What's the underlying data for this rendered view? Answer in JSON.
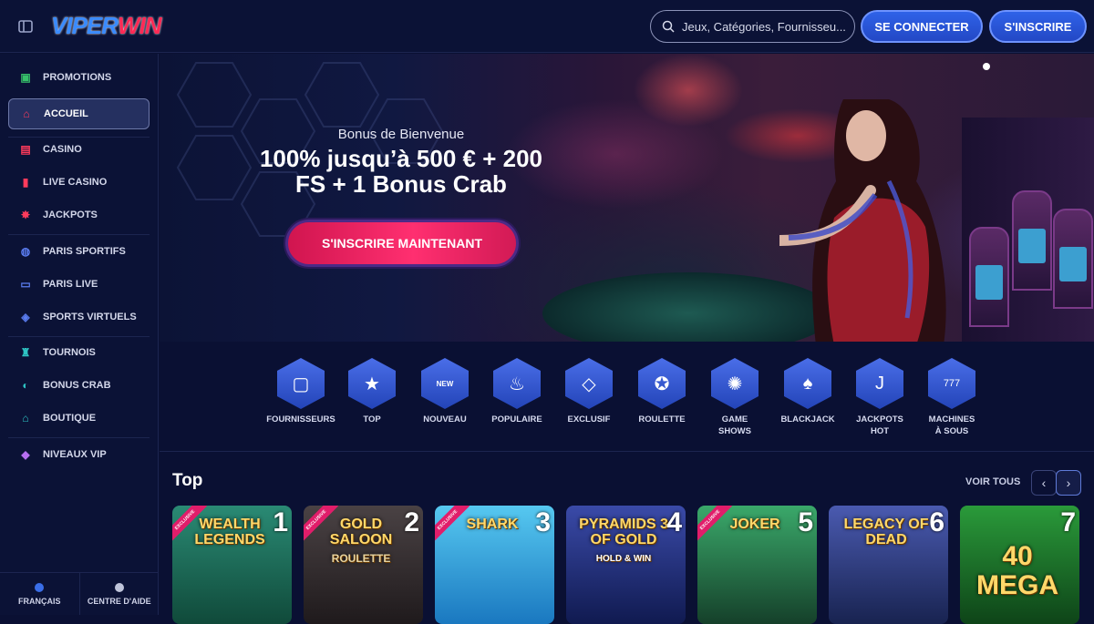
{
  "header": {
    "logo_part1": "VIPER",
    "logo_part2": "WIN",
    "search_placeholder": "Jeux, Catégories, Fournisseu...",
    "login_label": "SE CONNECTER",
    "signup_label": "S'INSCRIRE"
  },
  "sidebar": {
    "items": [
      {
        "label": "PROMOTIONS",
        "icon": "gift-icon",
        "color": "#37c06a"
      },
      {
        "label": "ACCUEIL",
        "icon": "home-icon",
        "color": "#ff3b5c"
      },
      {
        "label": "CASINO",
        "icon": "slot-machine-icon",
        "color": "#ff3b5c"
      },
      {
        "label": "LIVE CASINO",
        "icon": "cards-icon",
        "color": "#ff3b5c"
      },
      {
        "label": "JACKPOTS",
        "icon": "jackpot-icon",
        "color": "#ff3b5c"
      },
      {
        "label": "PARIS SPORTIFS",
        "icon": "ball-icon",
        "color": "#5a7cf0"
      },
      {
        "label": "PARIS LIVE",
        "icon": "live-icon",
        "color": "#5a7cf0"
      },
      {
        "label": "SPORTS VIRTUELS",
        "icon": "gamepad-icon",
        "color": "#5a7cf0"
      },
      {
        "label": "TOURNOIS",
        "icon": "trophy-icon",
        "color": "#2ec4c4"
      },
      {
        "label": "BONUS CRAB",
        "icon": "crab-icon",
        "color": "#2ec4c4"
      },
      {
        "label": "BOUTIQUE",
        "icon": "bag-icon",
        "color": "#2ec4c4"
      },
      {
        "label": "NIVEAUX VIP",
        "icon": "diamond-icon",
        "color": "#b56ef0"
      }
    ],
    "language_label": "FRANÇAIS",
    "help_label": "CENTRE D'AIDE"
  },
  "hero": {
    "subtitle": "Bonus de Bienvenue",
    "title_line1": "100% jusqu’à 500 € + 200",
    "title_line2": "FS + 1 Bonus Crab",
    "cta_label": "S'INSCRIRE MAINTENANT"
  },
  "categories": [
    {
      "line1": "FOURNISSEURS",
      "line2": "",
      "icon": "providers-icon"
    },
    {
      "line1": "TOP",
      "line2": "",
      "icon": "star-icon"
    },
    {
      "line1": "NOUVEAU",
      "line2": "",
      "icon": "new-icon"
    },
    {
      "line1": "POPULAIRE",
      "line2": "",
      "icon": "flame-icon"
    },
    {
      "line1": "EXCLUSIF",
      "line2": "",
      "icon": "diamond-icon"
    },
    {
      "line1": "ROULETTE",
      "line2": "",
      "icon": "roulette-icon"
    },
    {
      "line1": "GAME",
      "line2": "SHOWS",
      "icon": "wheel-icon"
    },
    {
      "line1": "BLACKJACK",
      "line2": "",
      "icon": "cards-icon"
    },
    {
      "line1": "JACKPOTS",
      "line2": "HOT",
      "icon": "jackpot-icon"
    },
    {
      "line1": "MACHINES",
      "line2": "À SOUS",
      "icon": "slot-machine-icon"
    }
  ],
  "top_section": {
    "title": "Top",
    "see_all_label": "VOIR TOUS",
    "games": [
      {
        "rank": "1",
        "name": "WEALTH LEGENDS",
        "sub": "",
        "exclusive": true,
        "bg": "#1f6b5a"
      },
      {
        "rank": "2",
        "name": "GOLD SALOON",
        "sub": "ROULETTE",
        "exclusive": true,
        "bg": "#3a3436"
      },
      {
        "rank": "3",
        "name": "SHARK",
        "sub": "",
        "exclusive": true,
        "bg": "#2aa6e0"
      },
      {
        "rank": "4",
        "name": "PYRAMIDS 3 OF GOLD",
        "sub": "HOLD & WIN",
        "exclusive": false,
        "bg": "#2a3a8a"
      },
      {
        "rank": "5",
        "name": "JOKER",
        "sub": "",
        "exclusive": true,
        "bg": "#2b7a4a"
      },
      {
        "rank": "6",
        "name": "LEGACY OF DEAD",
        "sub": "",
        "exclusive": false,
        "bg": "#3a4a80"
      },
      {
        "rank": "7",
        "name": "40 MEGA",
        "sub": "",
        "exclusive": false,
        "bg": "#1e6e2c"
      }
    ],
    "exclusive_label": "EXCLUSIVE"
  }
}
